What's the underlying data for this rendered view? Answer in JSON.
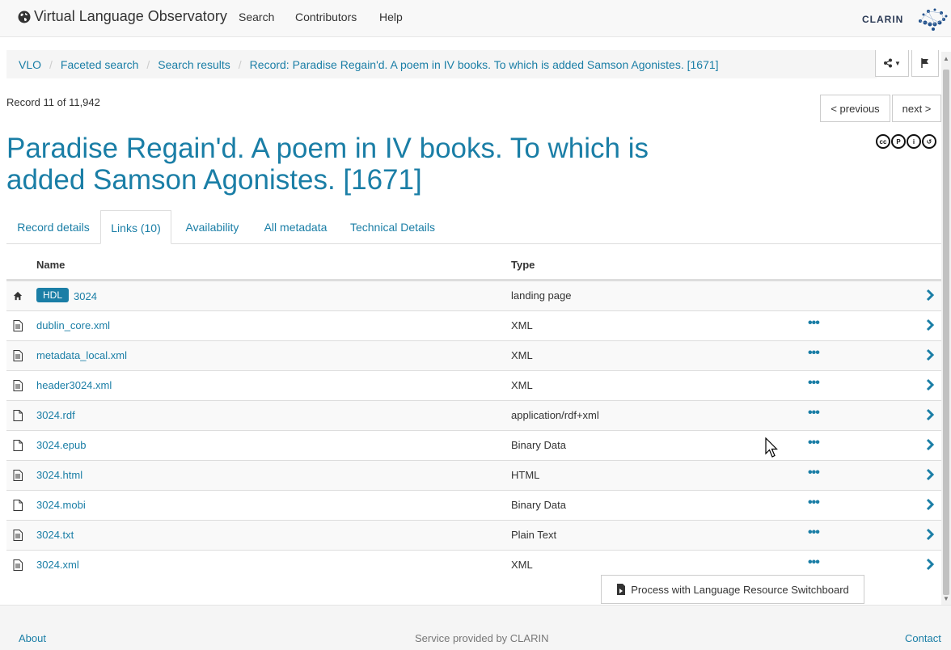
{
  "navbar": {
    "brand": "Virtual Language Observatory",
    "links": [
      "Search",
      "Contributors",
      "Help"
    ],
    "logo_text": "CLARIN"
  },
  "breadcrumb": [
    "VLO",
    "Faceted search",
    "Search results",
    "Record: Paradise Regain'd. A poem in IV books. To which is added Samson Agonistes. [1671]"
  ],
  "record": {
    "count": "Record 11 of 11,942",
    "previous": "< previous",
    "next": "next >",
    "title": "Paradise Regain'd. A poem in IV books. To which is added Samson Agonistes. [1671]"
  },
  "tabs": [
    "Record details",
    "Links (10)",
    "Availability",
    "All metadata",
    "Technical Details"
  ],
  "table": {
    "headers": {
      "name": "Name",
      "type": "Type"
    },
    "rows": [
      {
        "badge": "HDL",
        "name": "3024",
        "type": "landing page",
        "icon": "home-icon"
      },
      {
        "name": "dublin_core.xml",
        "type": "XML",
        "icon": "file-text-icon"
      },
      {
        "name": "metadata_local.xml",
        "type": "XML",
        "icon": "file-text-icon"
      },
      {
        "name": "header3024.xml",
        "type": "XML",
        "icon": "file-text-icon"
      },
      {
        "name": "3024.rdf",
        "type": "application/rdf+xml",
        "icon": "file-icon"
      },
      {
        "name": "3024.epub",
        "type": "Binary Data",
        "icon": "file-icon"
      },
      {
        "name": "3024.html",
        "type": "HTML",
        "icon": "file-text-icon"
      },
      {
        "name": "3024.mobi",
        "type": "Binary Data",
        "icon": "file-icon"
      },
      {
        "name": "3024.txt",
        "type": "Plain Text",
        "icon": "file-text-icon"
      },
      {
        "name": "3024.xml",
        "type": "XML",
        "icon": "file-text-icon"
      }
    ]
  },
  "switchboard_label": "Process with Language Resource Switchboard",
  "footer": {
    "about": "About",
    "service": "Service provided by CLARIN",
    "contact": "Contact"
  },
  "colors": {
    "link": "#1a7ea6"
  }
}
